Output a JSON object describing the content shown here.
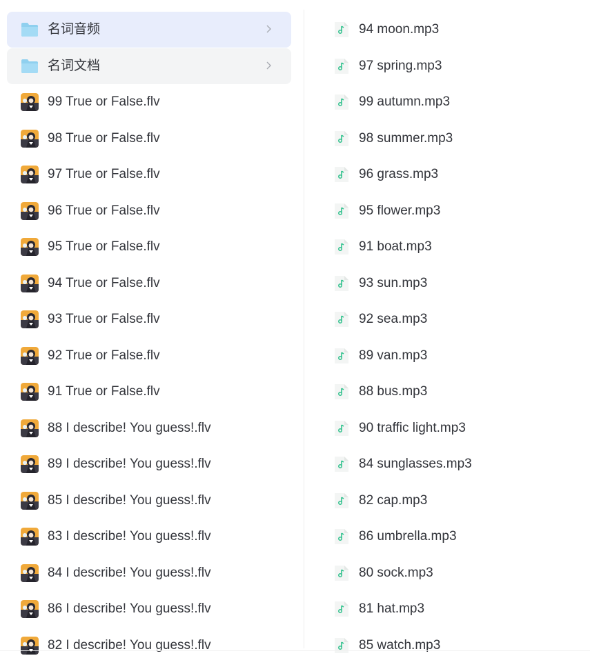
{
  "left": {
    "folders": [
      {
        "label": "名词音频",
        "icon": "folder-icon",
        "state": "selected"
      },
      {
        "label": "名词文档",
        "icon": "folder-icon",
        "state": "hover"
      }
    ],
    "files": [
      {
        "label": "99 True or False.flv",
        "icon": "video-thumbnail-icon"
      },
      {
        "label": "98 True or False.flv",
        "icon": "video-thumbnail-icon"
      },
      {
        "label": "97 True or False.flv",
        "icon": "video-thumbnail-icon"
      },
      {
        "label": "96 True or False.flv",
        "icon": "video-thumbnail-icon"
      },
      {
        "label": "95 True or False.flv",
        "icon": "video-thumbnail-icon"
      },
      {
        "label": "94 True or False.flv",
        "icon": "video-thumbnail-icon"
      },
      {
        "label": "93 True or False.flv",
        "icon": "video-thumbnail-icon"
      },
      {
        "label": "92 True or False.flv",
        "icon": "video-thumbnail-icon"
      },
      {
        "label": "91 True or False.flv",
        "icon": "video-thumbnail-icon"
      },
      {
        "label": "88 I describe! You guess!.flv",
        "icon": "video-thumbnail-icon"
      },
      {
        "label": "89 I describe! You guess!.flv",
        "icon": "video-thumbnail-icon"
      },
      {
        "label": "85 I describe! You guess!.flv",
        "icon": "video-thumbnail-icon"
      },
      {
        "label": "83 I describe! You guess!.flv",
        "icon": "video-thumbnail-icon"
      },
      {
        "label": "84 I describe! You guess!.flv",
        "icon": "video-thumbnail-icon"
      },
      {
        "label": "86 I describe! You guess!.flv",
        "icon": "video-thumbnail-icon"
      },
      {
        "label": "82 I describe! You guess!.flv",
        "icon": "video-thumbnail-icon"
      }
    ]
  },
  "right": {
    "files": [
      {
        "label": "94 moon.mp3",
        "icon": "audio-file-icon"
      },
      {
        "label": "97 spring.mp3",
        "icon": "audio-file-icon"
      },
      {
        "label": "99 autumn.mp3",
        "icon": "audio-file-icon"
      },
      {
        "label": "98 summer.mp3",
        "icon": "audio-file-icon"
      },
      {
        "label": "96 grass.mp3",
        "icon": "audio-file-icon"
      },
      {
        "label": "95 flower.mp3",
        "icon": "audio-file-icon"
      },
      {
        "label": "91 boat.mp3",
        "icon": "audio-file-icon"
      },
      {
        "label": "93 sun.mp3",
        "icon": "audio-file-icon"
      },
      {
        "label": "92 sea.mp3",
        "icon": "audio-file-icon"
      },
      {
        "label": "89 van.mp3",
        "icon": "audio-file-icon"
      },
      {
        "label": "88 bus.mp3",
        "icon": "audio-file-icon"
      },
      {
        "label": "90 traffic light.mp3",
        "icon": "audio-file-icon"
      },
      {
        "label": "84 sunglasses.mp3",
        "icon": "audio-file-icon"
      },
      {
        "label": "82 cap.mp3",
        "icon": "audio-file-icon"
      },
      {
        "label": "86 umbrella.mp3",
        "icon": "audio-file-icon"
      },
      {
        "label": "80 sock.mp3",
        "icon": "audio-file-icon"
      },
      {
        "label": "81 hat.mp3",
        "icon": "audio-file-icon"
      },
      {
        "label": "85 watch.mp3",
        "icon": "audio-file-icon"
      }
    ]
  },
  "colors": {
    "selected_row": "#e8edfc",
    "hover_row": "#f3f4f5",
    "folder": "#8fd0ef",
    "audio_accent": "#2fc18c",
    "text": "#33353b"
  }
}
